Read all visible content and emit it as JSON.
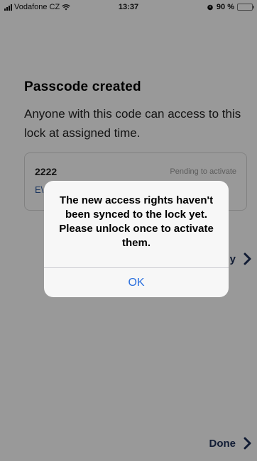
{
  "status_bar": {
    "carrier": "Vodafone CZ",
    "time": "13:37",
    "battery": "90 %",
    "battery_level": 0.9,
    "icons": [
      "signal-icon",
      "wifi-icon",
      "alarm-icon",
      "battery-icon"
    ]
  },
  "page": {
    "title": "Passcode created",
    "subtitle": "Anyone with this code can access to this lock at assigned time."
  },
  "code_card": {
    "code": "2222",
    "status": "Pending to activate",
    "validity_partial": "E\\"
  },
  "copy_action": {
    "label_partial": "y",
    "icon": "chevron-right-icon"
  },
  "done_action": {
    "label": "Done",
    "icon": "chevron-right-icon"
  },
  "alert": {
    "message": "The new access rights haven't been synced to the lock yet. Please unlock once to activate them.",
    "ok_label": "OK"
  },
  "colors": {
    "accent": "#1d2f57",
    "ios_blue": "#2a6fde",
    "battery_green": "#4cd964",
    "overlay": "rgba(0,0,0,0.40)"
  }
}
